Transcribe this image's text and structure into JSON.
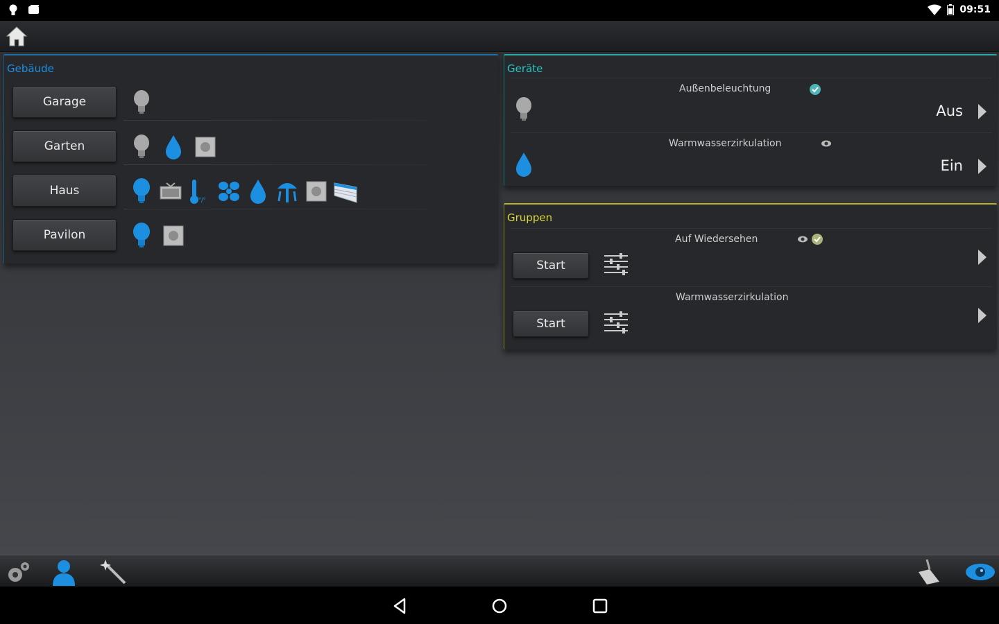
{
  "status_bar": {
    "time": "09:51"
  },
  "gebaeude": {
    "title": "Gebäude",
    "rooms": [
      {
        "label": "Garage"
      },
      {
        "label": "Garten"
      },
      {
        "label": "Haus"
      },
      {
        "label": "Pavilon"
      }
    ]
  },
  "geraete": {
    "title": "Geräte",
    "devices": [
      {
        "name": "Außenbeleuchtung",
        "state": "Aus"
      },
      {
        "name": "Warmwasserzirkulation",
        "state": "Ein"
      }
    ]
  },
  "gruppen": {
    "title": "Gruppen",
    "groups": [
      {
        "name": "Auf Wiedersehen",
        "button": "Start"
      },
      {
        "name": "Warmwasserzirkulation",
        "button": "Start"
      }
    ]
  },
  "colors": {
    "accent_blue": "#1d8fe0",
    "geraete_cyan": "#2ac4c4",
    "gruppen_yellow": "#d9d63a"
  },
  "icons": [
    "home-icon",
    "settings-icon",
    "user-icon",
    "magic-wand-icon",
    "clean-icon",
    "eye-icon",
    "bulb-icon",
    "water-drop-icon",
    "socket-icon",
    "tv-icon",
    "thermometer-icon",
    "fan-icon",
    "sprinkler-icon",
    "blinds-icon",
    "sliders-icon"
  ]
}
